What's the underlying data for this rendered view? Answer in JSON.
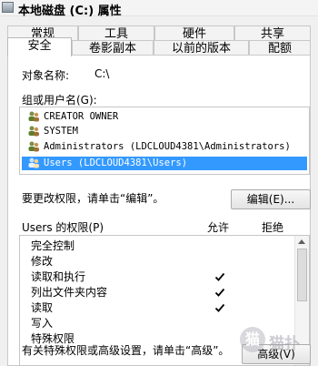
{
  "window": {
    "title": "本地磁盘 (C:) 属性",
    "icon": "drive-icon"
  },
  "tabs": {
    "row1": [
      {
        "label": "常规"
      },
      {
        "label": "工具"
      },
      {
        "label": "硬件"
      },
      {
        "label": "共享"
      }
    ],
    "row2": [
      {
        "label": "安全",
        "active": true
      },
      {
        "label": "卷影副本"
      },
      {
        "label": "以前的版本"
      },
      {
        "label": "配额"
      }
    ]
  },
  "object": {
    "label": "对象名称:",
    "value": "C:\\"
  },
  "groups": {
    "label": "组或用户名(G):",
    "items": [
      {
        "name": "CREATOR OWNER",
        "icon": "user-group-icon"
      },
      {
        "name": "SYSTEM",
        "icon": "user-group-icon"
      },
      {
        "name": "Administrators (LDCLOUD4381\\Administrators)",
        "icon": "user-group-icon"
      },
      {
        "name": "Users (LDCLOUD4381\\Users)",
        "icon": "user-group-icon",
        "selected": true
      }
    ]
  },
  "edit": {
    "hint": "要更改权限，请单击“编辑”。",
    "button": "编辑(E)..."
  },
  "permissions": {
    "title": "Users 的权限(P)",
    "allow_label": "允许",
    "deny_label": "拒绝",
    "items": [
      {
        "name": "完全控制",
        "allow": false,
        "deny": false
      },
      {
        "name": "修改",
        "allow": false,
        "deny": false
      },
      {
        "name": "读取和执行",
        "allow": true,
        "deny": false
      },
      {
        "name": "列出文件夹内容",
        "allow": true,
        "deny": false
      },
      {
        "name": "读取",
        "allow": true,
        "deny": false
      },
      {
        "name": "写入",
        "allow": false,
        "deny": false
      },
      {
        "name": "特殊权限",
        "allow": false,
        "deny": false
      }
    ]
  },
  "advanced": {
    "hint": "有关特殊权限或高级设置，请单击“高级”。",
    "button": "高级(V)"
  },
  "watermark": {
    "symbol": "猫",
    "text": "猫扑"
  },
  "colors": {
    "selection": "#3399ff",
    "panel": "#ffffff",
    "window": "#f0f0f0"
  }
}
